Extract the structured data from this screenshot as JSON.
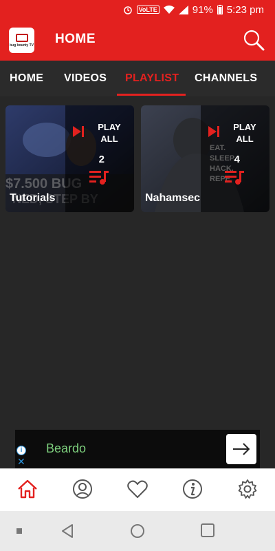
{
  "status_bar": {
    "battery": "91%",
    "time": "5:23 pm",
    "network_label": "VoLTE"
  },
  "app_bar": {
    "title": "HOME",
    "logo_text": "bug bounty TV"
  },
  "tabs": [
    {
      "label": "HOME",
      "active": false
    },
    {
      "label": "VIDEOS",
      "active": false
    },
    {
      "label": "PLAYLIST",
      "active": true
    },
    {
      "label": "CHANNELS",
      "active": false
    }
  ],
  "playlists": [
    {
      "title": "Tutorials",
      "play_label": "PLAY ALL",
      "count": "2"
    },
    {
      "title": "Nahamsec",
      "play_label": "PLAY ALL",
      "count": "4"
    }
  ],
  "ad": {
    "text": "Beardo"
  },
  "bottom_nav": [
    "home-icon",
    "profile-icon",
    "heart-icon",
    "info-icon",
    "gear-icon"
  ],
  "colors": {
    "accent": "#e3211f",
    "background": "#272727",
    "ad_text": "#7ed07e"
  }
}
